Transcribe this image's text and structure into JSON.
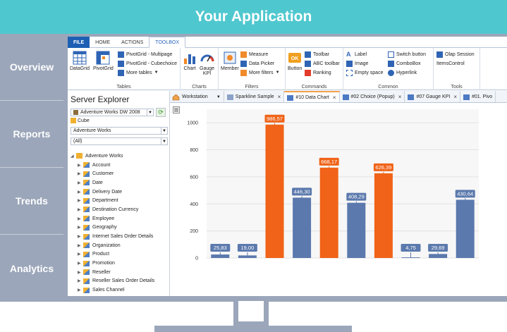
{
  "header": {
    "title": "Your Application"
  },
  "nav": {
    "items": [
      "Overview",
      "Reports",
      "Trends",
      "Analytics"
    ]
  },
  "ribbon": {
    "tabs": [
      "FILE",
      "HOME",
      "ACTIONS",
      "TOOLBOX"
    ],
    "groups": {
      "tables": {
        "label": "Tables",
        "datagrid": "DataGrid",
        "pivotgrid": "PivotGrid",
        "pivot_multipage": "PivotGrid - Multipage",
        "pivot_cubechoice": "PivotGrid - Cubechoice",
        "more_tables": "More tables"
      },
      "charts": {
        "label": "Charts",
        "chart": "Chart",
        "gauge": "Gauge",
        "kpi": "KPI"
      },
      "filters": {
        "label": "Filters",
        "member": "Member",
        "measure": "Measure",
        "date_picker": "Data Picker",
        "more_filters": "More filters"
      },
      "commands": {
        "label": "Commands",
        "button": "Button",
        "toolbar": "Toolbar",
        "abc_toolbar": "ABC toolbar",
        "ranking": "Ranking"
      },
      "common": {
        "label": "Common",
        "label_item": "Label",
        "image": "Image",
        "empty_space": "Empty space",
        "switch_button": "Switch button",
        "combobox": "ComboBox",
        "hyperlink": "Hyperlink"
      },
      "tools": {
        "label": "Tools",
        "olap_session": "Olap Session",
        "items_control": "ItemsControl"
      }
    }
  },
  "explorer": {
    "title": "Server Explorer",
    "connection": "Adventure Works DW 2008",
    "cube_label": "Cube",
    "cube_value": "Adventure Works",
    "perspective": "(All)",
    "root": "Adventure Works",
    "items": [
      "Account",
      "Customer",
      "Date",
      "Delivery Date",
      "Department",
      "Destination Currency",
      "Employee",
      "Geography",
      "Internet Sales Order Details",
      "Organization",
      "Product",
      "Promotion",
      "Reseller",
      "Reseller Sales Order Details",
      "Sales Channel"
    ]
  },
  "doc_tabs": [
    "Workstation",
    "Sparkline Sample",
    "#10 Data Chart",
    "#02 Choice (Popup)",
    "#07 Gauge KPI",
    "#01. Pivo"
  ],
  "colors": {
    "blue": "#5b79ad",
    "orange": "#f06318",
    "teal": "#4fc7cf",
    "frame": "#9ba6ba"
  },
  "chart_data": {
    "type": "bar",
    "values": [
      25.83,
      19.0,
      986.57,
      446.3,
      668.17,
      408.29,
      626.39,
      4.75,
      29.69,
      430.64
    ],
    "labels": [
      "25,83",
      "19,00",
      "986,57",
      "446,30",
      "668,17",
      "408,29",
      "626,39",
      "4,75",
      "29,69",
      "430,64"
    ],
    "colors": [
      "#5b79ad",
      "#5b79ad",
      "#f06318",
      "#5b79ad",
      "#f06318",
      "#5b79ad",
      "#f06318",
      "#5b79ad",
      "#5b79ad",
      "#5b79ad"
    ],
    "yticks": [
      "0",
      "200",
      "400",
      "600",
      "800",
      "1000"
    ],
    "ylim": [
      0,
      1100
    ],
    "grid": true
  }
}
